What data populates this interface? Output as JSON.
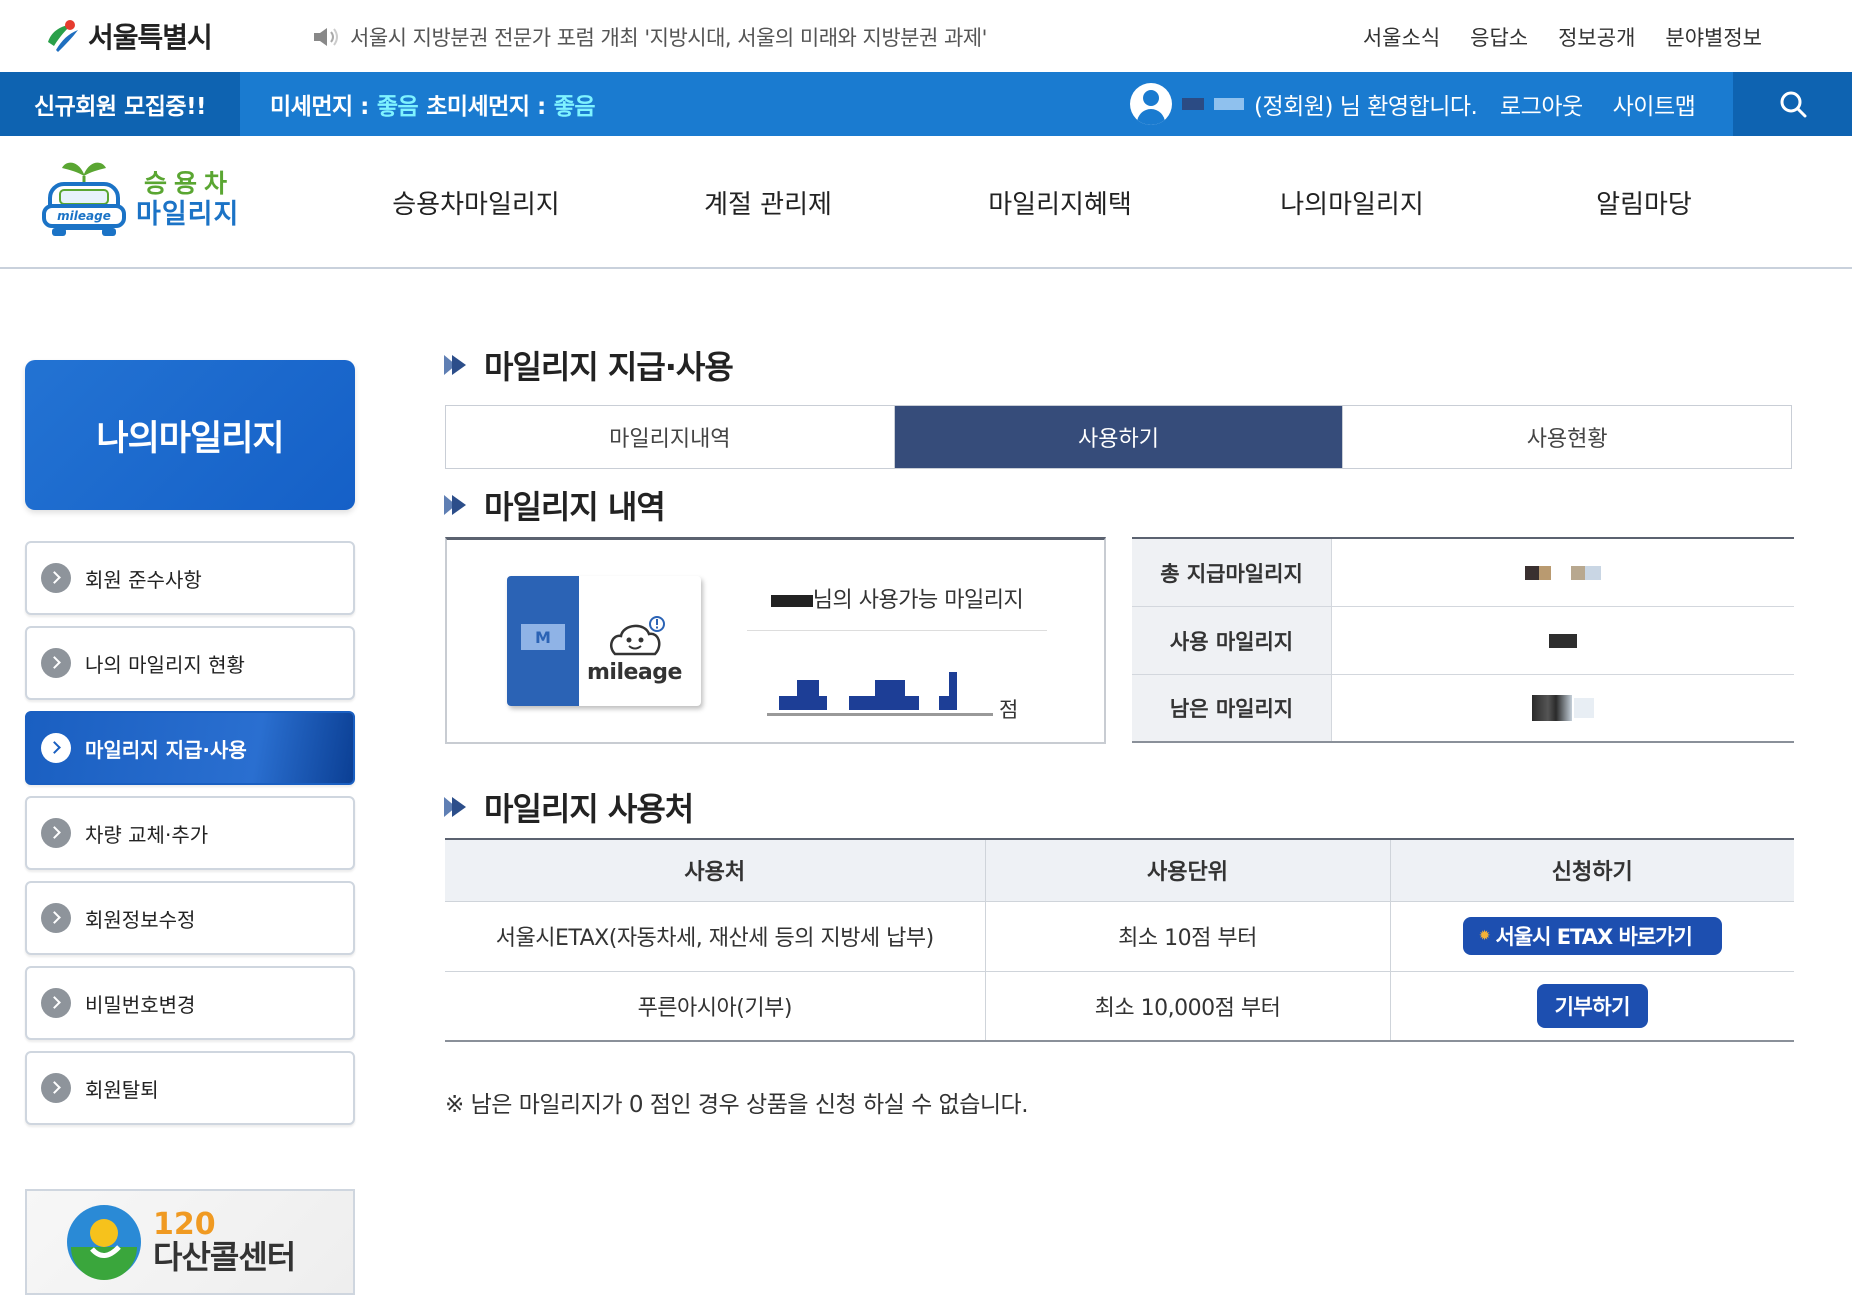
{
  "top": {
    "logo_text": "서울특별시",
    "notice": "서울시 지방분권 전문가 포럼 개최 '지방시대, 서울의 미래와 지방분권 과제'",
    "links": [
      "서울소식",
      "응답소",
      "정보공개",
      "분야별정보"
    ]
  },
  "bluebar": {
    "recruit": "신규회원 모집중!!",
    "fine_dust_label": "미세먼지 :",
    "fine_dust_value": "좋음",
    "ultra_dust_label": "초미세먼지 :",
    "ultra_dust_value": "좋음",
    "welcome": "(정회원) 님 환영합니다.",
    "logout": "로그아웃",
    "sitemap": "사이트맵"
  },
  "brand": {
    "line1": "승용차",
    "line2": "마일리지",
    "car_badge": "mileage"
  },
  "gnb": [
    "승용차마일리지",
    "계절 관리제",
    "마일리지혜택",
    "나의마일리지",
    "알림마당"
  ],
  "lnb": {
    "title": "나의마일리지",
    "items": [
      "회원 준수사항",
      "나의 마일리지 현황",
      "마일리지 지급·사용",
      "차량 교체·추가",
      "회원정보수정",
      "비밀번호변경",
      "회원탈퇴"
    ],
    "active_index": 2
  },
  "callcenter": {
    "number": "120",
    "name": "다산콜센터"
  },
  "content": {
    "title": "마일리지 지급·사용",
    "tabs": [
      "마일리지내역",
      "사용하기",
      "사용현황"
    ],
    "active_tab": 1,
    "history_title": "마일리지 내역",
    "card_tag": "M",
    "card_label": "mileage",
    "available_label": "님의 사용가능 마일리지",
    "points_unit": "점",
    "stats": [
      {
        "label": "총 지급마일리지"
      },
      {
        "label": "사용 마일리지"
      },
      {
        "label": "남은 마일리지"
      }
    ],
    "places_title": "마일리지 사용처",
    "table": {
      "headers": [
        "사용처",
        "사용단위",
        "신청하기"
      ],
      "rows": [
        {
          "place": "서울시ETAX(자동차세, 재산세 등의 지방세 납부)",
          "unit": "최소 10점 부터",
          "action": "서울시 ETAX 바로가기"
        },
        {
          "place": "푸른아시아(기부)",
          "unit": "최소 10,000점 부터",
          "action": "기부하기"
        }
      ]
    },
    "footnote": "※ 남은 마일리지가 0 점인 경우 상품을 신청 하실 수 없습니다."
  },
  "colors": {
    "primary_blue": "#1a7bd0",
    "dark_blue": "#0e63b1",
    "tab_active": "#364c7a",
    "button_blue": "#1d4fb0",
    "dust_good": "#7ff3ff"
  }
}
